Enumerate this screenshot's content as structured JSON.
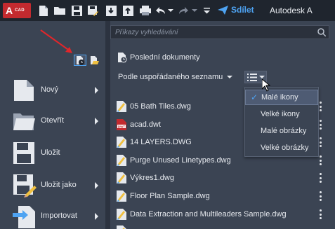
{
  "toolbar": {
    "logo_letter": "A",
    "logo_sub": "CAD",
    "share_label": "Sdílet",
    "app_title": "Autodesk A"
  },
  "search": {
    "placeholder": "Příkazy vyhledávání"
  },
  "left_menu": [
    {
      "label": "Nový",
      "icon": "new-document-icon",
      "has_submenu": true
    },
    {
      "label": "Otevřít",
      "icon": "folder-open-icon",
      "has_submenu": true
    },
    {
      "label": "Uložit",
      "icon": "floppy-disk-icon",
      "has_submenu": false
    },
    {
      "label": "Uložit jako",
      "icon": "save-as-icon",
      "has_submenu": true
    },
    {
      "label": "Importovat",
      "icon": "import-icon",
      "has_submenu": true
    }
  ],
  "recent": {
    "title": "Poslední dokumenty",
    "sort_label": "Podle uspořádaného seznamu",
    "files": [
      {
        "name": "05 Bath Tiles.dwg",
        "type": "dwg"
      },
      {
        "name": "acad.dwt",
        "type": "dwt"
      },
      {
        "name": "14 LAYERS.DWG",
        "type": "dwg"
      },
      {
        "name": "Purge Unused Linetypes.dwg",
        "type": "dwg"
      },
      {
        "name": "Výkres1.dwg",
        "type": "dwg"
      },
      {
        "name": "Floor Plan Sample.dwg",
        "type": "dwg"
      },
      {
        "name": "Data Extraction and Multileaders Sample.dwg",
        "type": "dwg"
      }
    ]
  },
  "view_menu": {
    "items": [
      "Malé ikony",
      "Velké ikony",
      "Malé obrázky",
      "Velké obrázky"
    ],
    "selected_index": 0
  },
  "colors": {
    "accent": "#4ea3f2",
    "logo_red": "#c32a2f",
    "annotation_arrow": "#e0262b"
  }
}
